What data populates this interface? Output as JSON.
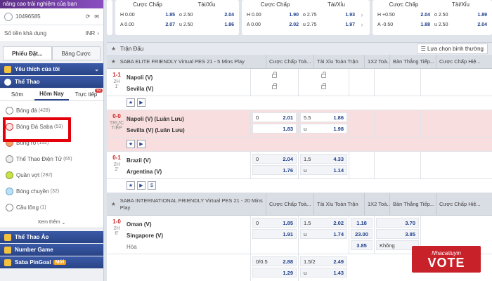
{
  "sidebar": {
    "promo_text": "nâng cao trải nghiệm của bạn",
    "account_id": "10496585",
    "balance_label": "Số tiền khả dụng",
    "currency": "INR",
    "slip_tabs": [
      "Phiếu Đặt...",
      "Bảng Cược"
    ],
    "favorites_label": "Yêu thích của tôi",
    "sports_label": "Thể Thao",
    "time_tabs": [
      "Sớm",
      "Hôm Nay",
      "Trực tiếp"
    ],
    "live_badge": "92",
    "sports": [
      {
        "name": "Bóng đá",
        "count": "(428)"
      },
      {
        "name": "Bóng Đá Saba",
        "count": "(53)"
      },
      {
        "name": "Bóng rổ",
        "count": "(152)"
      },
      {
        "name": "Thể Thao Điện Tử",
        "count": "(65)"
      },
      {
        "name": "Quần vợt",
        "count": "(282)"
      },
      {
        "name": "Bóng chuyền",
        "count": "(32)"
      },
      {
        "name": "Cầu lông",
        "count": "(1)"
      }
    ],
    "see_more": "Xem thêm",
    "virtual_label": "Thể Thao Ảo",
    "number_game_label": "Number Game",
    "pingoal_label": "Saba PinGoal",
    "new_tag": "Mới"
  },
  "top_cards": [
    {
      "h1": "Cược Chấp",
      "h2": "Tài/Xỉu",
      "r1": [
        "H 0.00",
        "1.85",
        "o 2.50",
        "2.04"
      ],
      "r2": [
        "A 0.00",
        "2.07",
        "u 2.50",
        "1.86"
      ]
    },
    {
      "h1": "Cược Chấp",
      "h2": "Tài/Xỉu",
      "r1": [
        "H 0.00",
        "1.90",
        "o 2.75",
        "1.93"
      ],
      "r2": [
        "A 0.00",
        "2.02",
        "u 2.75",
        "1.97"
      ]
    },
    {
      "h1": "Cược Chấp",
      "h2": "Tài/Xỉu",
      "r1": [
        "H +0.50",
        "2.04",
        "o 2.50",
        "1.89"
      ],
      "r2": [
        "A -0.50",
        "1.88",
        "u 2.50",
        "2.04"
      ]
    }
  ],
  "bar": {
    "title": "Trận Đấu",
    "filter": "Lựa chọn bình thường"
  },
  "columns": [
    "Cược Chấp Toà...",
    "Tài Xỉu Toàn Trận",
    "1X2 Toà...",
    "Bàn Thắng Tiếp...",
    "Cược Chấp Hiệ..."
  ],
  "leagues": [
    {
      "name": "SABA ELITE FRIENDLY Virtual PES 21 - 5 Mins Play",
      "matches": [
        {
          "score": "1-1",
          "half": "2H",
          "time": "1'",
          "home": "Napoli (V)",
          "away": "Sevilla (V)",
          "locked": true
        },
        {
          "score": "0-0",
          "half": "TRỰC",
          "time": "TIẾP",
          "home": "Napoli (V) (Luân Lưu)",
          "away": "Sevilla (V) (Luân Lưu)",
          "live": true,
          "hdp": [
            [
              "0",
              "2.01"
            ],
            [
              "",
              "1.83"
            ]
          ],
          "ou": [
            [
              "5.5",
              "1.86"
            ],
            [
              "u",
              "1.98"
            ]
          ]
        },
        {
          "score": "0-1",
          "half": "2H",
          "time": "2'",
          "home": "Brazil (V)",
          "away": "Argentina (V)",
          "hdp": [
            [
              "0",
              "2.04"
            ],
            [
              "",
              "1.76"
            ]
          ],
          "ou": [
            [
              "1.5",
              "4.33"
            ],
            [
              "u",
              "1.14"
            ]
          ]
        }
      ]
    },
    {
      "name": "SABA INTERNATIONAL FRIENDLY Virtual PES 21 - 20 Mins Play",
      "matches": [
        {
          "score": "1-0",
          "half": "2H",
          "time": "6'",
          "home": "Oman (V)",
          "away": "Singapore (V)",
          "draw": "Hòa",
          "hdp": [
            [
              "0",
              "1.85"
            ],
            [
              "",
              "1.91"
            ]
          ],
          "ou": [
            [
              "1.5",
              "2.02"
            ],
            [
              "u",
              "1.74"
            ]
          ],
          "x12": [
            "1.18",
            "23.00",
            "3.85"
          ],
          "next": [
            "3.70",
            "3.85",
            "Không"
          ],
          "hdp2": [
            [
              "0/0.5",
              "2.88"
            ],
            [
              "",
              "1.29"
            ]
          ],
          "ou2": [
            [
              "1.5/2",
              "2.49"
            ],
            [
              "u",
              "1.43"
            ]
          ]
        }
      ]
    }
  ],
  "watermark": {
    "top": "Nhacaituyin",
    "main": "VOTE"
  }
}
